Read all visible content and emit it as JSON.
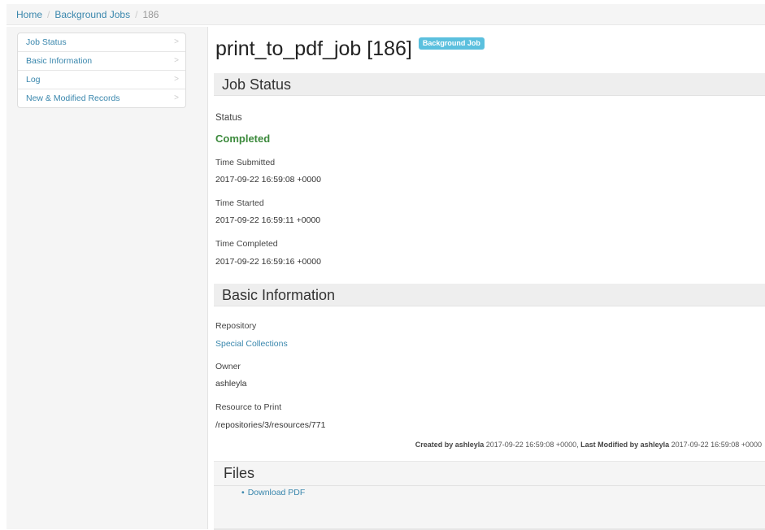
{
  "breadcrumb": {
    "home": "Home",
    "jobs": "Background Jobs",
    "current": "186",
    "separator": "/"
  },
  "sidebar": {
    "items": [
      {
        "label": "Job Status"
      },
      {
        "label": "Basic Information"
      },
      {
        "label": "Log"
      },
      {
        "label": "New & Modified Records"
      }
    ],
    "chevron": ">"
  },
  "header": {
    "title": "print_to_pdf_job [186]",
    "badge": "Background Job"
  },
  "job_status": {
    "heading": "Job Status",
    "status_label": "Status",
    "status_value": "Completed",
    "submitted_label": "Time Submitted",
    "submitted_value": "2017-09-22 16:59:08 +0000",
    "started_label": "Time Started",
    "started_value": "2017-09-22 16:59:11 +0000",
    "completed_label": "Time Completed",
    "completed_value": "2017-09-22 16:59:16 +0000"
  },
  "basic_info": {
    "heading": "Basic Information",
    "repository_label": "Repository",
    "repository_value": "Special Collections",
    "owner_label": "Owner",
    "owner_value": "ashleyla",
    "resource_label": "Resource to Print",
    "resource_value": "/repositories/3/resources/771"
  },
  "meta": {
    "created_prefix": "Created by ashleyla",
    "created_time": " 2017-09-22 16:59:08 +0000, ",
    "modified_prefix": "Last Modified by ashleyla",
    "modified_time": " 2017-09-22 16:59:08 +0000"
  },
  "files": {
    "heading": "Files",
    "items": [
      {
        "label": "Download PDF"
      }
    ]
  },
  "colors": {
    "link": "#3a87ad",
    "badge": "#5bc0de",
    "status_completed": "#3c8a3c"
  }
}
